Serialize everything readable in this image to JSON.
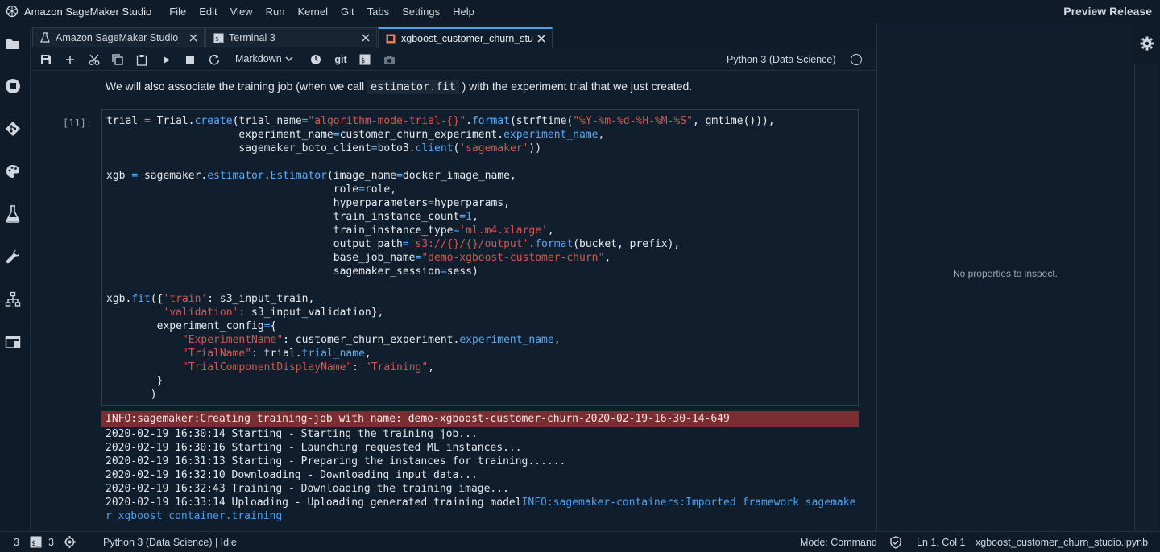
{
  "app": {
    "title": "Amazon SageMaker Studio",
    "preview_label": "Preview Release"
  },
  "menu": [
    "File",
    "Edit",
    "View",
    "Run",
    "Kernel",
    "Git",
    "Tabs",
    "Settings",
    "Help"
  ],
  "sidebar_icons": [
    "folder-icon",
    "stop-circle-icon",
    "git-icon",
    "palette-icon",
    "flask-icon",
    "wrench-icon",
    "hierarchy-icon",
    "window-icon"
  ],
  "tabs": [
    {
      "label": "Amazon SageMaker Studio",
      "icon": "flask-icon"
    },
    {
      "label": "Terminal 3",
      "icon": "terminal-icon"
    },
    {
      "label": "xgboost_customer_churn_stu",
      "icon": "notebook-icon",
      "active": true
    }
  ],
  "toolbar": {
    "cell_type": "Markdown",
    "git_label": "git",
    "kernel_name": "Python 3 (Data Science)"
  },
  "notebook": {
    "markdown_before": "We will also associate the training job (when we call",
    "markdown_code": "estimator.fit",
    "markdown_after": ") with the experiment trial that we just created.",
    "prompt": "[11]:",
    "code_lines": [
      [
        [
          "trial ",
          ""
        ],
        [
          "=",
          "kw"
        ],
        [
          " Trial.",
          ""
        ],
        [
          "create",
          "kw"
        ],
        [
          "(trial_name",
          ""
        ],
        [
          "=",
          "kw"
        ],
        [
          "\"algorithm-mode-trial-{}\"",
          "st"
        ],
        [
          ".",
          ""
        ],
        [
          "format",
          "kw"
        ],
        [
          "(strftime(",
          ""
        ],
        [
          "\"%Y-%m-%d-%H-%M-%S\"",
          "st"
        ],
        [
          ", gmtime())),",
          ""
        ]
      ],
      [
        [
          "                     experiment_name",
          ""
        ],
        [
          "=",
          "kw"
        ],
        [
          "customer_churn_experiment.",
          ""
        ],
        [
          "experiment_name",
          "kw"
        ],
        [
          ",",
          ""
        ]
      ],
      [
        [
          "                     sagemaker_boto_client",
          ""
        ],
        [
          "=",
          "kw"
        ],
        [
          "boto3.",
          ""
        ],
        [
          "client",
          "kw"
        ],
        [
          "(",
          ""
        ],
        [
          "'sagemaker'",
          "st"
        ],
        [
          "))",
          ""
        ]
      ],
      [
        [
          "",
          ""
        ]
      ],
      [
        [
          "xgb ",
          ""
        ],
        [
          "=",
          "kw"
        ],
        [
          " sagemaker.",
          ""
        ],
        [
          "estimator",
          "kw"
        ],
        [
          ".",
          ""
        ],
        [
          "Estimator",
          "kw"
        ],
        [
          "(image_name",
          ""
        ],
        [
          "=",
          "kw"
        ],
        [
          "docker_image_name,",
          ""
        ]
      ],
      [
        [
          "                                    role",
          ""
        ],
        [
          "=",
          "kw"
        ],
        [
          "role,",
          ""
        ]
      ],
      [
        [
          "                                    hyperparameters",
          ""
        ],
        [
          "=",
          "kw"
        ],
        [
          "hyperparams,",
          ""
        ]
      ],
      [
        [
          "                                    train_instance_count",
          ""
        ],
        [
          "=",
          "kw"
        ],
        [
          "1",
          "kw"
        ],
        [
          ",",
          ""
        ]
      ],
      [
        [
          "                                    train_instance_type",
          ""
        ],
        [
          "=",
          "kw"
        ],
        [
          "'ml.m4.xlarge'",
          "st"
        ],
        [
          ",",
          ""
        ]
      ],
      [
        [
          "                                    output_path",
          ""
        ],
        [
          "=",
          "kw"
        ],
        [
          "'s3://{}/{}/output'",
          "st"
        ],
        [
          ".",
          ""
        ],
        [
          "format",
          "kw"
        ],
        [
          "(bucket, prefix),",
          ""
        ]
      ],
      [
        [
          "                                    base_job_name",
          ""
        ],
        [
          "=",
          "kw"
        ],
        [
          "\"demo-xgboost-customer-churn\"",
          "st"
        ],
        [
          ",",
          ""
        ]
      ],
      [
        [
          "                                    sagemaker_session",
          ""
        ],
        [
          "=",
          "kw"
        ],
        [
          "sess)",
          ""
        ]
      ],
      [
        [
          "",
          ""
        ]
      ],
      [
        [
          "xgb.",
          ""
        ],
        [
          "fit",
          "kw"
        ],
        [
          "({",
          ""
        ],
        [
          "'train'",
          "st"
        ],
        [
          ": s3_input_train,",
          ""
        ]
      ],
      [
        [
          "         ",
          ""
        ],
        [
          "'validation'",
          "st"
        ],
        [
          ": s3_input_validation},",
          ""
        ]
      ],
      [
        [
          "        experiment_config",
          ""
        ],
        [
          "=",
          "kw"
        ],
        [
          "{",
          ""
        ]
      ],
      [
        [
          "            ",
          ""
        ],
        [
          "\"ExperimentName\"",
          "st"
        ],
        [
          ": customer_churn_experiment.",
          ""
        ],
        [
          "experiment_name",
          "kw"
        ],
        [
          ",",
          ""
        ]
      ],
      [
        [
          "            ",
          ""
        ],
        [
          "\"TrialName\"",
          "st"
        ],
        [
          ": trial.",
          ""
        ],
        [
          "trial_name",
          "kw"
        ],
        [
          ",",
          ""
        ]
      ],
      [
        [
          "            ",
          ""
        ],
        [
          "\"TrialComponentDisplayName\"",
          "st"
        ],
        [
          ": ",
          ""
        ],
        [
          "\"Training\"",
          "st"
        ],
        [
          ",",
          ""
        ]
      ],
      [
        [
          "        }",
          ""
        ]
      ],
      [
        [
          "       )",
          ""
        ]
      ]
    ],
    "output_info": "INFO:sagemaker:Creating training-job with name: demo-xgboost-customer-churn-2020-02-19-16-30-14-649",
    "output_lines": [
      "2020-02-19 16:30:14 Starting - Starting the training job...",
      "2020-02-19 16:30:16 Starting - Launching requested ML instances...",
      "2020-02-19 16:31:13 Starting - Preparing the instances for training......",
      "2020-02-19 16:32:10 Downloading - Downloading input data...",
      "2020-02-19 16:32:43 Training - Downloading the training image..."
    ],
    "output_upload_line": "2020-02-19 16:33:14 Uploading - Uploading generated training model",
    "output_upload_info": "INFO:sagemaker-containers:Imported framework sagemake",
    "output_upload_info_wrap": "r_xgboost_container.training"
  },
  "inspector": {
    "message": "No properties to inspect."
  },
  "statusbar": {
    "count_1": "3",
    "count_2": "3",
    "kernel_status": "Python 3 (Data Science) | Idle",
    "mode": "Mode: Command",
    "position": "Ln 1, Col 1",
    "filename": "xgboost_customer_churn_studio.ipynb"
  },
  "colors": {
    "background": "#0f1b29",
    "accent": "#4aa5f0",
    "error_row": "#7a2e31",
    "string": "#d0584f",
    "keyword": "#5aa9f5"
  }
}
